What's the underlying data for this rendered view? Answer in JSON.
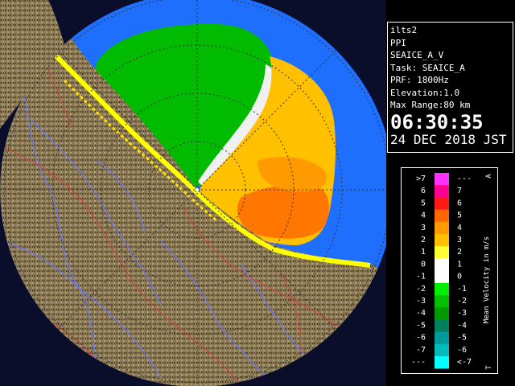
{
  "info": {
    "station": "ilts2",
    "mode": "PPI",
    "product": "SEAICE_A_V",
    "task": "Task: SEAICE_A",
    "prf": "PRF: 1800Hz",
    "elevation": "Elevation:1.0",
    "max_range": "Max Range:80 km",
    "time": "06:30:35",
    "date": "24 DEC 2018 JST"
  },
  "legend": {
    "title": "Mean Velocity in m/s",
    "top_marker": "A",
    "bottom_marker": "T",
    "rows": [
      {
        "left": ">7",
        "right": "---",
        "color": "#ff33ff"
      },
      {
        "left": "6",
        "right": "7",
        "color": "#ff0090"
      },
      {
        "left": "5",
        "right": "6",
        "color": "#ff1a1a"
      },
      {
        "left": "4",
        "right": "5",
        "color": "#ff6600"
      },
      {
        "left": "3",
        "right": "4",
        "color": "#ff9a00"
      },
      {
        "left": "2",
        "right": "3",
        "color": "#ffc000"
      },
      {
        "left": "1",
        "right": "2",
        "color": "#ffff33"
      },
      {
        "left": "0",
        "right": "1",
        "color": "#ffffff"
      },
      {
        "left": "-1",
        "right": "0",
        "color": "#ffffff"
      },
      {
        "left": "-2",
        "right": "-1",
        "color": "#00ee00"
      },
      {
        "left": "-3",
        "right": "-2",
        "color": "#00c000"
      },
      {
        "left": "-4",
        "right": "-3",
        "color": "#009900"
      },
      {
        "left": "-5",
        "right": "-4",
        "color": "#008060"
      },
      {
        "left": "-6",
        "right": "-5",
        "color": "#009999"
      },
      {
        "left": "-7",
        "right": "-6",
        "color": "#00bbbb"
      },
      {
        "left": "---",
        "right": "<-7",
        "color": "#00ffff"
      }
    ]
  },
  "colors": {
    "sea": "#1f6fff",
    "outside": "#0a0e2a",
    "land": "#8c7a55",
    "river": "#6677ff",
    "road": "#cc4444",
    "approaching": "#00bb00",
    "receding": "#ff9a00",
    "coast_echo": "#ffff00",
    "range_ring": "#333333"
  }
}
